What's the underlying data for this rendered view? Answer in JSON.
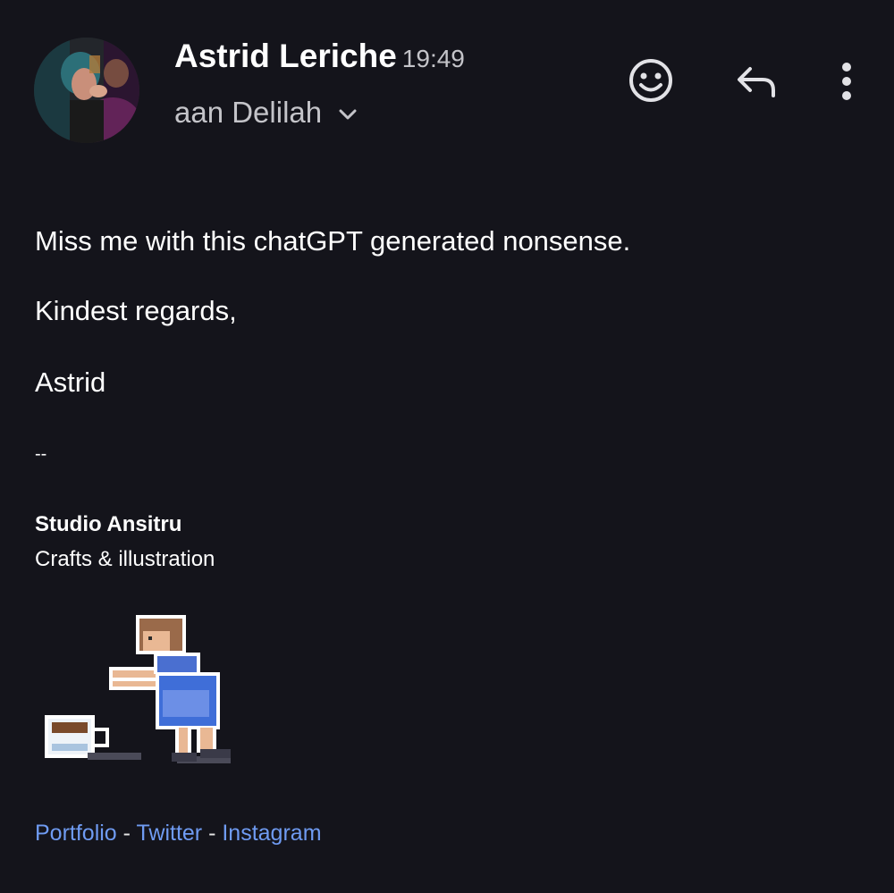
{
  "header": {
    "sender_name": "Astrid Leriche",
    "time": "19:49",
    "recipient": "aan Delilah",
    "avatar_icon": "profile-photo",
    "actions": [
      {
        "name": "emoji-reaction",
        "icon": "smiley-icon"
      },
      {
        "name": "reply",
        "icon": "reply-arrow-icon"
      },
      {
        "name": "more-options",
        "icon": "vertical-dots-icon"
      }
    ]
  },
  "message": {
    "line1": "Miss me with this chatGPT generated nonsense.",
    "line2": "Kindest regards,",
    "line3": "Astrid"
  },
  "signature": {
    "separator": "--",
    "studio": "Studio Ansitru",
    "tagline": "Crafts & illustration",
    "image_icon": "pixel-art-girl-spilling-coffee",
    "links": {
      "portfolio": "Portfolio",
      "twitter": "Twitter",
      "instagram": "Instagram",
      "separator": "-"
    }
  },
  "colors": {
    "background": "#14141b",
    "primary_text": "#ffffff",
    "secondary_text": "#c4c4c9",
    "link": "#6f9bf2"
  }
}
